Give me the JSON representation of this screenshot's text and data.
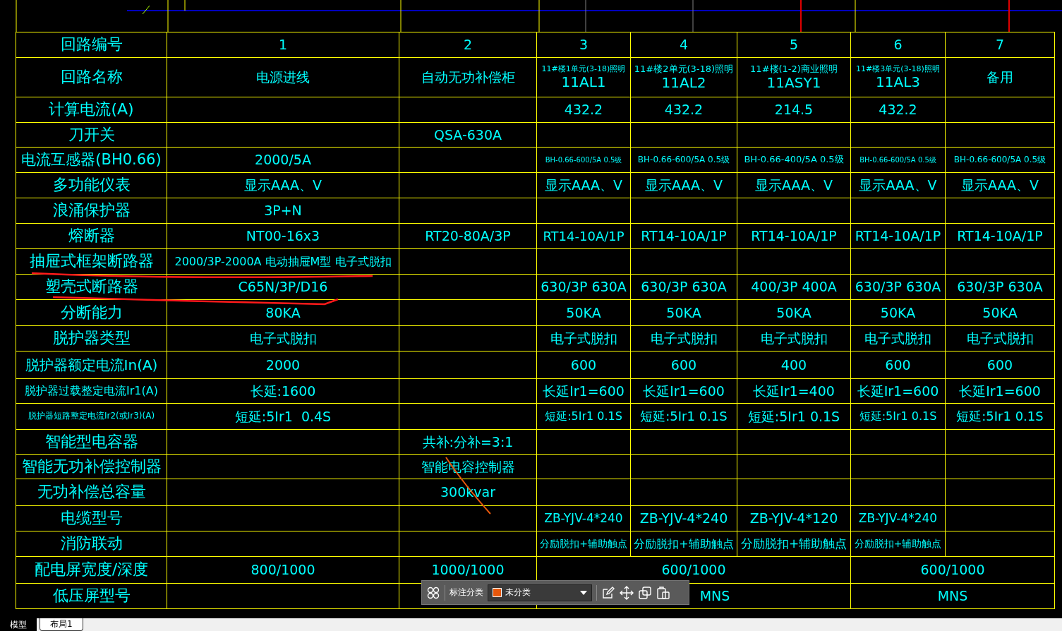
{
  "table": {
    "rows": [
      {
        "label": "回路编号",
        "cells": [
          "1",
          "2",
          "3",
          "4",
          "5",
          "6",
          "7"
        ]
      },
      {
        "label": "回路名称",
        "cells": [
          "电源进线",
          "自动无功补偿柜",
          {
            "lines": [
              "11#楼1单元(3-18)照明",
              "11AL1"
            ]
          },
          {
            "lines": [
              "11#楼2单元(3-18)照明",
              "11AL2"
            ]
          },
          {
            "lines": [
              "11#楼(1-2)商业照明",
              "11ASY1"
            ]
          },
          {
            "lines": [
              "11#楼3单元(3-18)照明",
              "11AL3"
            ]
          },
          "备用"
        ]
      },
      {
        "label": "计算电流(A)",
        "cells": [
          null,
          null,
          "432.2",
          "432.2",
          "214.5",
          "432.2",
          null
        ]
      },
      {
        "label": "刀开关",
        "cells": [
          null,
          "QSA-630A",
          null,
          null,
          null,
          null,
          null
        ]
      },
      {
        "label": "电流互感器(BH0.66)",
        "cells": [
          "2000/5A",
          null,
          "BH-0.66-600/5A 0.5级",
          "BH-0.66-600/5A 0.5级",
          "BH-0.66-400/5A 0.5级",
          "BH-0.66-600/5A 0.5级",
          "BH-0.66-600/5A 0.5级"
        ]
      },
      {
        "label": "多功能仪表",
        "cells": [
          "显示AAA、V",
          null,
          "显示AAA、V",
          "显示AAA、V",
          "显示AAA、V",
          "显示AAA、V",
          "显示AAA、V"
        ]
      },
      {
        "label": "浪涌保护器",
        "cells": [
          "3P+N",
          null,
          null,
          null,
          null,
          null,
          null
        ]
      },
      {
        "label": "熔断器",
        "cells": [
          "NT00-16x3",
          "RT20-80A/3P",
          "RT14-10A/1P",
          "RT14-10A/1P",
          "RT14-10A/1P",
          "RT14-10A/1P",
          "RT14-10A/1P"
        ]
      },
      {
        "label": "抽屉式框架断路器",
        "cells": [
          "2000/3P-2000A 电动抽屉M型 电子式脱扣",
          null,
          null,
          null,
          null,
          null,
          null
        ]
      },
      {
        "label": "塑壳式断路器",
        "cells": [
          "C65N/3P/D16",
          null,
          "630/3P 630A",
          "630/3P 630A",
          "400/3P 400A",
          "630/3P 630A",
          "630/3P 630A"
        ]
      },
      {
        "label": "分断能力",
        "cells": [
          "80KA",
          null,
          "50KA",
          "50KA",
          "50KA",
          "50KA",
          "50KA"
        ]
      },
      {
        "label": "脱护器类型",
        "cells": [
          "电子式脱扣",
          null,
          "电子式脱扣",
          "电子式脱扣",
          "电子式脱扣",
          "电子式脱扣",
          "电子式脱扣"
        ]
      },
      {
        "label": "脱护器额定电流In(A)",
        "cells": [
          "2000",
          null,
          "600",
          "600",
          "400",
          "600",
          "600"
        ]
      },
      {
        "label": "脱护器过载整定电流Ir1(A)",
        "cells": [
          "长延:1600",
          null,
          "长延Ir1=600",
          "长延Ir1=600",
          "长延Ir1=400",
          "长延Ir1=600",
          "长延Ir1=600"
        ]
      },
      {
        "label": "脱护器短路整定电流Ir2(或Ir3)(A)",
        "cells": [
          "短延:5Ir1  0.4S",
          null,
          "短延:5Ir1 0.1S",
          "短延:5Ir1 0.1S",
          "短延:5Ir1 0.1S",
          "短延:5Ir1 0.1S",
          "短延:5Ir1 0.1S"
        ]
      },
      {
        "label": "智能型电容器",
        "cells": [
          null,
          "共补:分补=3:1",
          null,
          null,
          null,
          null,
          null
        ]
      },
      {
        "label": "智能无功补偿控制器",
        "cells": [
          null,
          "智能电容控制器",
          null,
          null,
          null,
          null,
          null
        ]
      },
      {
        "label": "无功补偿总容量",
        "cells": [
          null,
          "300kvar",
          null,
          null,
          null,
          null,
          null
        ]
      },
      {
        "label": "电缆型号",
        "cells": [
          null,
          null,
          "ZB-YJV-4*240",
          "ZB-YJV-4*240",
          "ZB-YJV-4*120",
          "ZB-YJV-4*240",
          null
        ]
      },
      {
        "label": "消防联动",
        "cells": [
          null,
          null,
          "分励脱扣+辅助触点",
          "分励脱扣+辅助触点",
          "分励脱扣+辅助触点",
          "分励脱扣+辅助触点",
          null
        ]
      },
      {
        "label": "配电屏宽度/深度",
        "kind": "grouped",
        "cells": [
          "800/1000",
          "1000/1000",
          "600/1000",
          "600/1000"
        ]
      },
      {
        "label": "低压屏型号",
        "kind": "grouped_shifted",
        "cells": [
          null,
          null,
          "MNS",
          "MNS"
        ]
      }
    ]
  },
  "toolbar": {
    "label": "标注分类",
    "dropdown": {
      "value": "未分类"
    }
  },
  "tabs": [
    {
      "label": "模型",
      "selected": true
    },
    {
      "label": "布局1",
      "selected": false
    }
  ]
}
